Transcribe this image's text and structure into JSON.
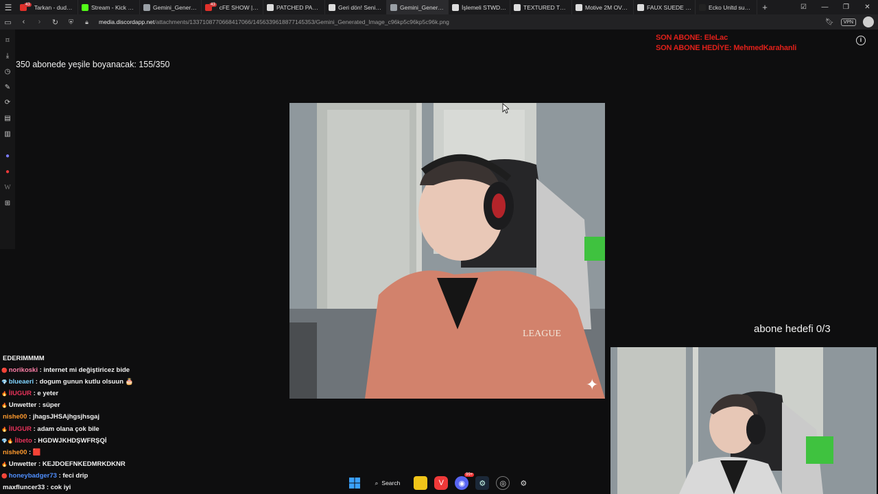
{
  "browser": {
    "tabs": [
      {
        "label": "Tarkan - dudu (slow",
        "fav": "#e0302a",
        "badge": "43"
      },
      {
        "label": "Stream - Kick Dashb",
        "fav": "#53fc18"
      },
      {
        "label": "Gemini_Generated_",
        "fav": "#9aa0a6"
      },
      {
        "label": "cFE SHOW | YILBAŞ",
        "fav": "#e0302a",
        "badge": "43"
      },
      {
        "label": "PATCHED PADDED",
        "fav": "#dddddd"
      },
      {
        "label": "Geri dön! Seni çok",
        "fav": "#dddddd"
      },
      {
        "label": "Gemini_Generated_",
        "fav": "#9aa0a6",
        "active": true
      },
      {
        "label": "İşlemeli STWD ceke",
        "fav": "#dddddd"
      },
      {
        "label": "TEXTURED TWILL J",
        "fav": "#dddddd"
      },
      {
        "label": "Motive 2M OVersiz",
        "fav": "#dddddd"
      },
      {
        "label": "FAUX SUEDE JACKE",
        "fav": "#dddddd"
      },
      {
        "label": "Ecko Unltd suni de",
        "fav": "#222222"
      }
    ],
    "url_domain": "media.discordapp.net",
    "url_path": "/attachments/1337108770668417066/1456339618877145353/Gemini_Generated_Image_c96kp5c96kp5c96k.png",
    "vpn_label": "VPN"
  },
  "overlay": {
    "sub_goal_text": "350 abonede yeşile boyanacak: 155/350",
    "last_sub": "SON ABONE: EleLac",
    "last_gift": "SON ABONE HEDİYE: MehmedKarahanli",
    "goal_right": "abone hedefi 0/3"
  },
  "chat": [
    {
      "user": "EDERIMMMM",
      "text": "",
      "color": "#f2f2f2",
      "badge": ""
    },
    {
      "user": "norikoski",
      "text": " : internet mi değiştiricez bide",
      "color": "#ff7fa8",
      "badge": "🔴"
    },
    {
      "user": "blueaeri",
      "text": " : dogum gunun kutlu olsuun 🎂",
      "color": "#7fd4ff",
      "badge": "💎"
    },
    {
      "user": "İlUGUR",
      "text": " : e yeter",
      "color": "#e8325a",
      "badge": "🔥"
    },
    {
      "user": "Unwetter",
      "text": " : süper",
      "color": "#f2f2f2",
      "badge": "🔥"
    },
    {
      "user": "nishe00",
      "text": " : jhagsJHSAjhgsjhsgaj",
      "color": "#ff9a2e",
      "badge": ""
    },
    {
      "user": "İlUGUR",
      "text": " : adam olana çok bile",
      "color": "#e8325a",
      "badge": "🔥"
    },
    {
      "user": "İlbeto",
      "text": " : HGDWJKHDŞWFRŞQİ",
      "color": "#e8325a",
      "badge": "💎🔥"
    },
    {
      "user": "nishe00",
      "text": " : 🟥",
      "color": "#ff9a2e",
      "badge": ""
    },
    {
      "user": "Unwetter",
      "text": " : KEJDOEFNKEDMRKDKNR",
      "color": "#f2f2f2",
      "badge": "🔥"
    },
    {
      "user": "honeybadger73",
      "text": " : feci drip",
      "color": "#4f8fff",
      "badge": "🔴"
    },
    {
      "user": "maxfluncer33",
      "text": " : cok iyi",
      "color": "#f2f2f2",
      "badge": ""
    }
  ],
  "taskbar": {
    "search_label": "Search",
    "discord_badge": "99+"
  },
  "icons": {
    "sidebar": [
      "bookmark-icon",
      "download-icon",
      "history-icon",
      "notes-icon",
      "translate-icon",
      "calendar-icon",
      "reader-icon",
      "mastodon-icon",
      "vivaldi-icon",
      "wikipedia-icon",
      "add-panel-icon"
    ]
  }
}
